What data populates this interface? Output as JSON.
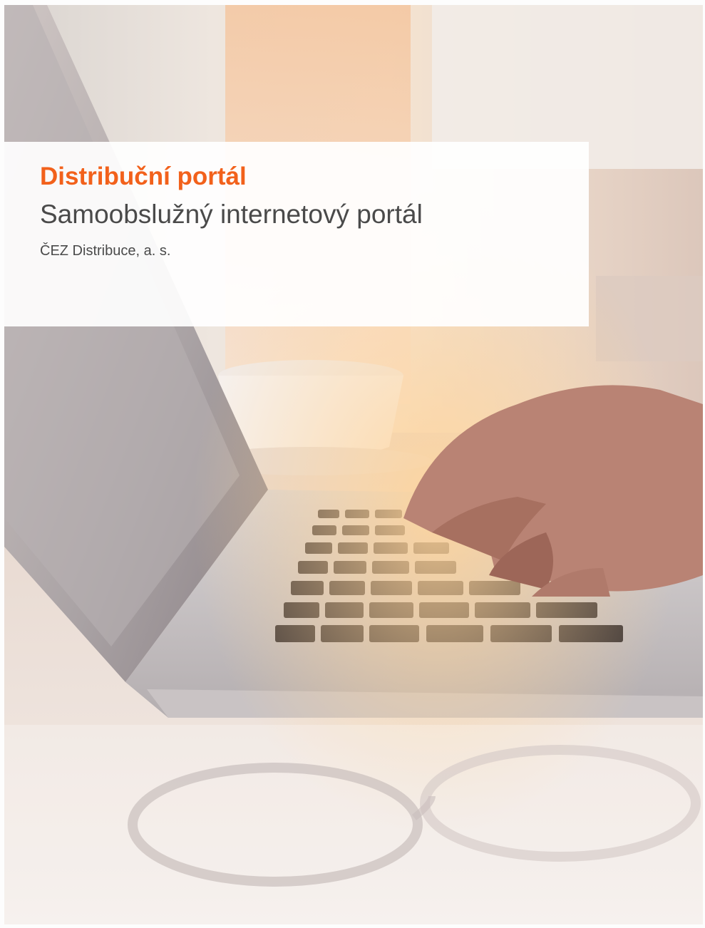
{
  "document": {
    "title": "Distribuční portál",
    "subtitle": "Samoobslužný internetový portál",
    "company": "ČEZ Distribuce, a. s."
  },
  "colors": {
    "accent": "#f2611b",
    "text_dark": "#4a4a4a",
    "box_background": "#ffffff"
  },
  "cover_image": {
    "icon": "laptop-typing-photo"
  }
}
